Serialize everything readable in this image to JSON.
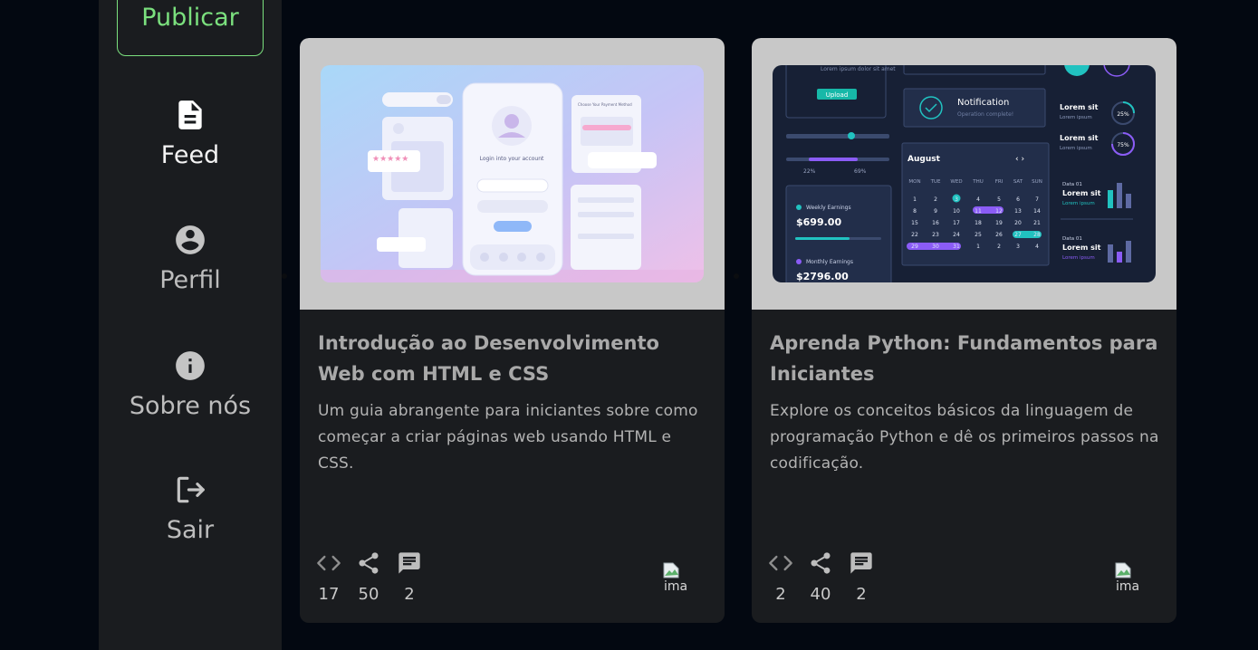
{
  "sidebar": {
    "publish_label": "Publicar",
    "items": [
      {
        "label": "Feed",
        "icon": "document-icon",
        "active": true
      },
      {
        "label": "Perfil",
        "icon": "account-circle-icon"
      },
      {
        "label": "Sobre nós",
        "icon": "info-icon"
      },
      {
        "label": "Sair",
        "icon": "logout-icon"
      }
    ]
  },
  "cards": [
    {
      "title": "Introdução ao Desenvolvimento Web com HTML e CSS",
      "description": "Um guia abrangente para iniciantes sobre como começar a criar páginas web usando HTML e CSS.",
      "stats": {
        "code": "17",
        "shares": "50",
        "comments": "2"
      },
      "avatar_alt": "ima",
      "thumbnail": {
        "theme": "mobile-login-ui-mockup",
        "texts": {
          "login_title": "Login into your account",
          "payment_title": "Choose Your Payment Method"
        }
      }
    },
    {
      "title": "Aprenda Python: Fundamentos para Iniciantes",
      "description": "Explore os conceitos básicos da linguagem de programação Python e dê os primeiros passos na codificação.",
      "stats": {
        "code": "2",
        "shares": "40",
        "comments": "2"
      },
      "avatar_alt": "ima",
      "thumbnail": {
        "theme": "dark-dashboard-ui-mockup",
        "texts": {
          "notification": "Notification",
          "notification_sub": "Operation complete!",
          "upload": "Upload",
          "calendar_month": "August",
          "weekly": "Weekly Earnings",
          "weekly_value": "$699.00",
          "monthly": "Monthly Earnings",
          "monthly_value": "$2796.00",
          "lorem": "Lorem sit",
          "lorem_sub": "Lorem ipsum",
          "pct_1": "25%",
          "pct_2": "75%",
          "data": "Data 01",
          "slider_min": "22%",
          "slider_max": "69%",
          "lorem_dolor": "Lorem ipsum dolor sit amet"
        }
      }
    }
  ],
  "colors": {
    "page_bg": "#030811",
    "panel_bg": "#1a1c1f",
    "accent_green": "#7be07e"
  }
}
